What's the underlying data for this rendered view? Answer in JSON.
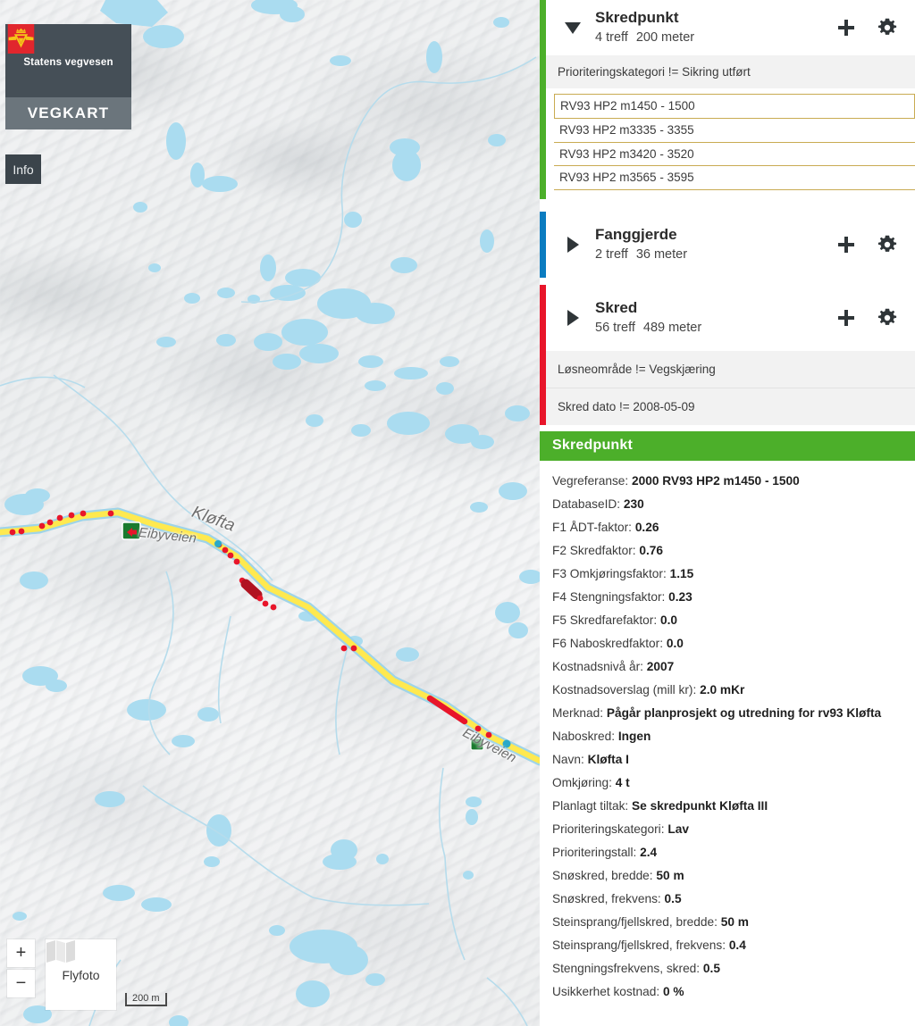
{
  "brand": {
    "org_name": "Statens vegvesen",
    "app_name": "VEGKART",
    "emblem_icon": "vegvesen-crown-wings-emblem",
    "info_label": "Info"
  },
  "map": {
    "labels": [
      {
        "text": "Kløfta",
        "name": "map-label-klofta"
      },
      {
        "text": "Eibyveien",
        "name": "map-label-eibyveien-west"
      },
      {
        "text": "Eibyveien",
        "name": "map-label-eibyveien-east"
      }
    ],
    "controls": {
      "zoom_in": "+",
      "zoom_out": "−",
      "basemap_label": "Flyfoto",
      "basemap_icon": "map-fold-icon",
      "scale_label": "200 m"
    }
  },
  "panel": {
    "objects": [
      {
        "id": "skredpunkt",
        "title": "Skredpunkt",
        "hits": "4 treff",
        "length": "200 meter",
        "expanded": true,
        "accent_color": "#4caf2a",
        "caret_icon": "chevron-down-icon",
        "add_icon": "plus-icon",
        "settings_icon": "gear-icon",
        "filters": [
          "Prioriteringskategori != Sikring utført"
        ],
        "results": [
          {
            "label": "RV93 HP2 m1450 - 1500",
            "selected": true
          },
          {
            "label": "RV93 HP2 m3335 - 3355",
            "selected": false
          },
          {
            "label": "RV93 HP2 m3420 - 3520",
            "selected": false
          },
          {
            "label": "RV93 HP2 m3565 - 3595",
            "selected": false
          }
        ]
      },
      {
        "id": "fanggjerde",
        "title": "Fanggjerde",
        "hits": "2 treff",
        "length": "36 meter",
        "expanded": false,
        "accent_color": "#0b7cc0",
        "caret_icon": "chevron-right-icon",
        "add_icon": "plus-icon",
        "settings_icon": "gear-icon",
        "filters": [],
        "results": []
      },
      {
        "id": "skred",
        "title": "Skred",
        "hits": "56 treff",
        "length": "489 meter",
        "expanded": false,
        "accent_color": "#e8152a",
        "caret_icon": "chevron-right-icon",
        "add_icon": "plus-icon",
        "settings_icon": "gear-icon",
        "filters": [
          "Løsneområde != Vegskjæring",
          "Skred dato != 2008-05-09"
        ],
        "results": []
      }
    ],
    "detail": {
      "header": "Skredpunkt",
      "header_color": "#4caf2a",
      "rows": [
        {
          "label": "Vegreferanse:",
          "value": "2000 RV93 HP2 m1450 - 1500"
        },
        {
          "label": "DatabaseID:",
          "value": "230"
        },
        {
          "label": "F1 ÅDT-faktor:",
          "value": "0.26"
        },
        {
          "label": "F2 Skredfaktor:",
          "value": "0.76"
        },
        {
          "label": "F3 Omkjøringsfaktor:",
          "value": "1.15"
        },
        {
          "label": "F4 Stengningsfaktor:",
          "value": "0.23"
        },
        {
          "label": "F5 Skredfarefaktor:",
          "value": "0.0"
        },
        {
          "label": "F6 Naboskredfaktor:",
          "value": "0.0"
        },
        {
          "label": "Kostnadsnivå år:",
          "value": "2007"
        },
        {
          "label": "Kostnadsoverslag (mill kr):",
          "value": "2.0 mKr"
        },
        {
          "label": "Merknad:",
          "value": "Pågår planprosjekt og utredning for rv93 Kløfta"
        },
        {
          "label": "Naboskred:",
          "value": "Ingen"
        },
        {
          "label": "Navn:",
          "value": "Kløfta I"
        },
        {
          "label": "Omkjøring:",
          "value": "4 t"
        },
        {
          "label": "Planlagt tiltak:",
          "value": "Se skredpunkt Kløfta III"
        },
        {
          "label": "Prioriteringskategori:",
          "value": "Lav"
        },
        {
          "label": "Prioriteringstall:",
          "value": "2.4"
        },
        {
          "label": "Snøskred, bredde:",
          "value": "50 m"
        },
        {
          "label": "Snøskred, frekvens:",
          "value": "0.5"
        },
        {
          "label": "Steinsprang/fjellskred, bredde:",
          "value": "50 m"
        },
        {
          "label": "Steinsprang/fjellskred, frekvens:",
          "value": "0.4"
        },
        {
          "label": "Stengningsfrekvens, skred:",
          "value": "0.5"
        },
        {
          "label": "Usikkerhet kostnad:",
          "value": "0 %"
        }
      ]
    }
  }
}
